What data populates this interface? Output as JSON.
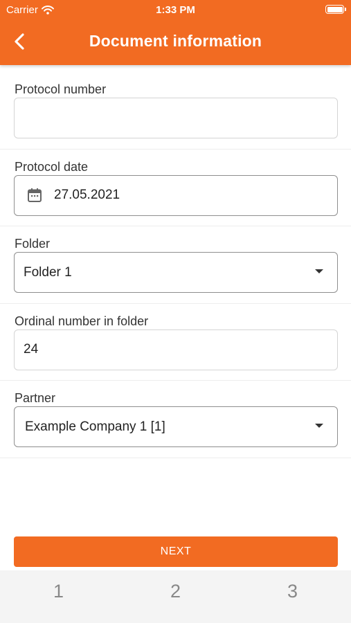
{
  "status_bar": {
    "carrier": "Carrier",
    "time": "1:33 PM"
  },
  "header": {
    "title": "Document information",
    "back_icon": "chevron-left-icon",
    "color": "#f26b22"
  },
  "form": {
    "protocol_number": {
      "label": "Protocol number",
      "value": ""
    },
    "protocol_date": {
      "label": "Protocol date",
      "value": "27.05.2021",
      "icon": "calendar-icon"
    },
    "folder": {
      "label": "Folder",
      "value": "Folder 1"
    },
    "ordinal_number": {
      "label": "Ordinal number in folder",
      "value": "24"
    },
    "partner": {
      "label": "Partner",
      "value": "Example Company 1 [1]"
    }
  },
  "next_label": "NEXT",
  "steps": [
    "1",
    "2",
    "3"
  ]
}
